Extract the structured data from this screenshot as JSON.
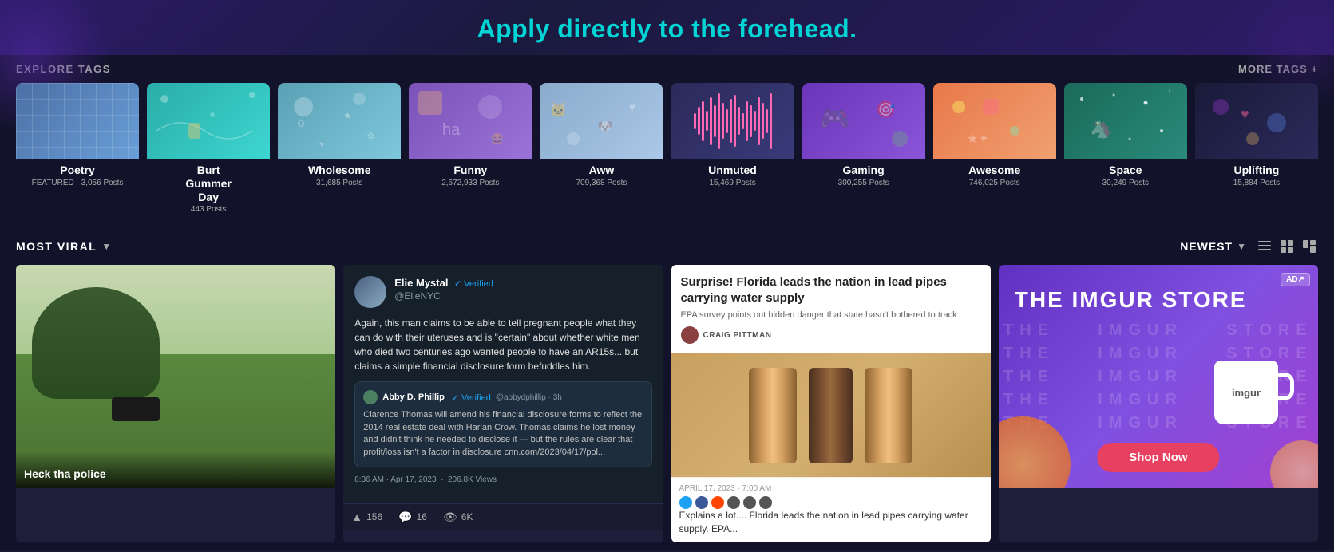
{
  "hero": {
    "tagline": "Apply directly to the forehead."
  },
  "explore_tags": {
    "section_title": "EXPLORE TAGS",
    "more_tags_label": "MORE TAGS +",
    "tags": [
      {
        "id": "poetry",
        "name": "Poetry",
        "meta": "FEATURED · 3,056 Posts",
        "theme": "poetry"
      },
      {
        "id": "burt-gummer-day",
        "name": "Burt\nGummer\nDay",
        "meta": "443 Posts",
        "theme": "burt"
      },
      {
        "id": "wholesome",
        "name": "Wholesome",
        "meta": "31,685 Posts",
        "theme": "wholesome"
      },
      {
        "id": "funny",
        "name": "Funny",
        "meta": "2,672,933 Posts",
        "theme": "funny"
      },
      {
        "id": "aww",
        "name": "Aww",
        "meta": "709,368 Posts",
        "theme": "aww"
      },
      {
        "id": "unmuted",
        "name": "Unmuted",
        "meta": "15,469 Posts",
        "theme": "unmuted"
      },
      {
        "id": "gaming",
        "name": "Gaming",
        "meta": "300,255 Posts",
        "theme": "gaming"
      },
      {
        "id": "awesome",
        "name": "Awesome",
        "meta": "746,025 Posts",
        "theme": "awesome"
      },
      {
        "id": "space",
        "name": "Space",
        "meta": "30,249 Posts",
        "theme": "space"
      },
      {
        "id": "uplifting",
        "name": "Uplifting",
        "meta": "15,884 Posts",
        "theme": "uplifting"
      }
    ]
  },
  "most_viral": {
    "section_title": "MOST VIRAL",
    "sort_label": "NEWEST",
    "posts": [
      {
        "id": "post1",
        "type": "image",
        "caption": "Heck tha police"
      },
      {
        "id": "post2",
        "type": "tweet",
        "author": "Elie Mystal",
        "handle": "@ElieNYC",
        "verified": true,
        "text": "Again, this man claims to be able to tell pregnant people what they can do with their uteruses and is \"certain\" about whether white men who died two centuries ago wanted people to have an AR15s... but claims a simple financial disclosure form befuddles him.",
        "quoted_author": "Abby D. Phillip",
        "quoted_handle": "@abbydphillip · 3h",
        "quoted_verified": true,
        "quoted_text": "Clarence Thomas will amend his financial disclosure forms to reflect the 2014 real estate deal with Harlan Crow. Thomas claims he lost money and didn't think he needed to disclose it — but the rules are clear that profit/loss isn't a factor in disclosure cnn.com/2023/04/17/pol...",
        "timestamp": "8:36 AM · Apr 17, 2023",
        "views": "206.8K Views",
        "upvotes": "156",
        "comments": "16",
        "views_count": "6K"
      },
      {
        "id": "post3",
        "type": "article",
        "title": "Surprise! Florida leads the nation in lead pipes carrying water supply",
        "subtitle": "EPA survey points out hidden danger that state hasn't bothered to track",
        "author": "CRAIG PITTMAN",
        "date": "APRIL 17, 2023 · 7:00 AM",
        "caption": "Explains a lot.... Florida leads the nation in lead pipes carrying water supply. EPA..."
      },
      {
        "id": "post4",
        "type": "ad",
        "store_name": "THE IMGUR STORE",
        "watermark_rows": [
          "THE STORE",
          "THE STORE",
          "THE STORE",
          "THE STORE"
        ],
        "mug_brand": "imgur",
        "cta_label": "Shop Now",
        "ad_badge": "AD↗"
      }
    ]
  }
}
